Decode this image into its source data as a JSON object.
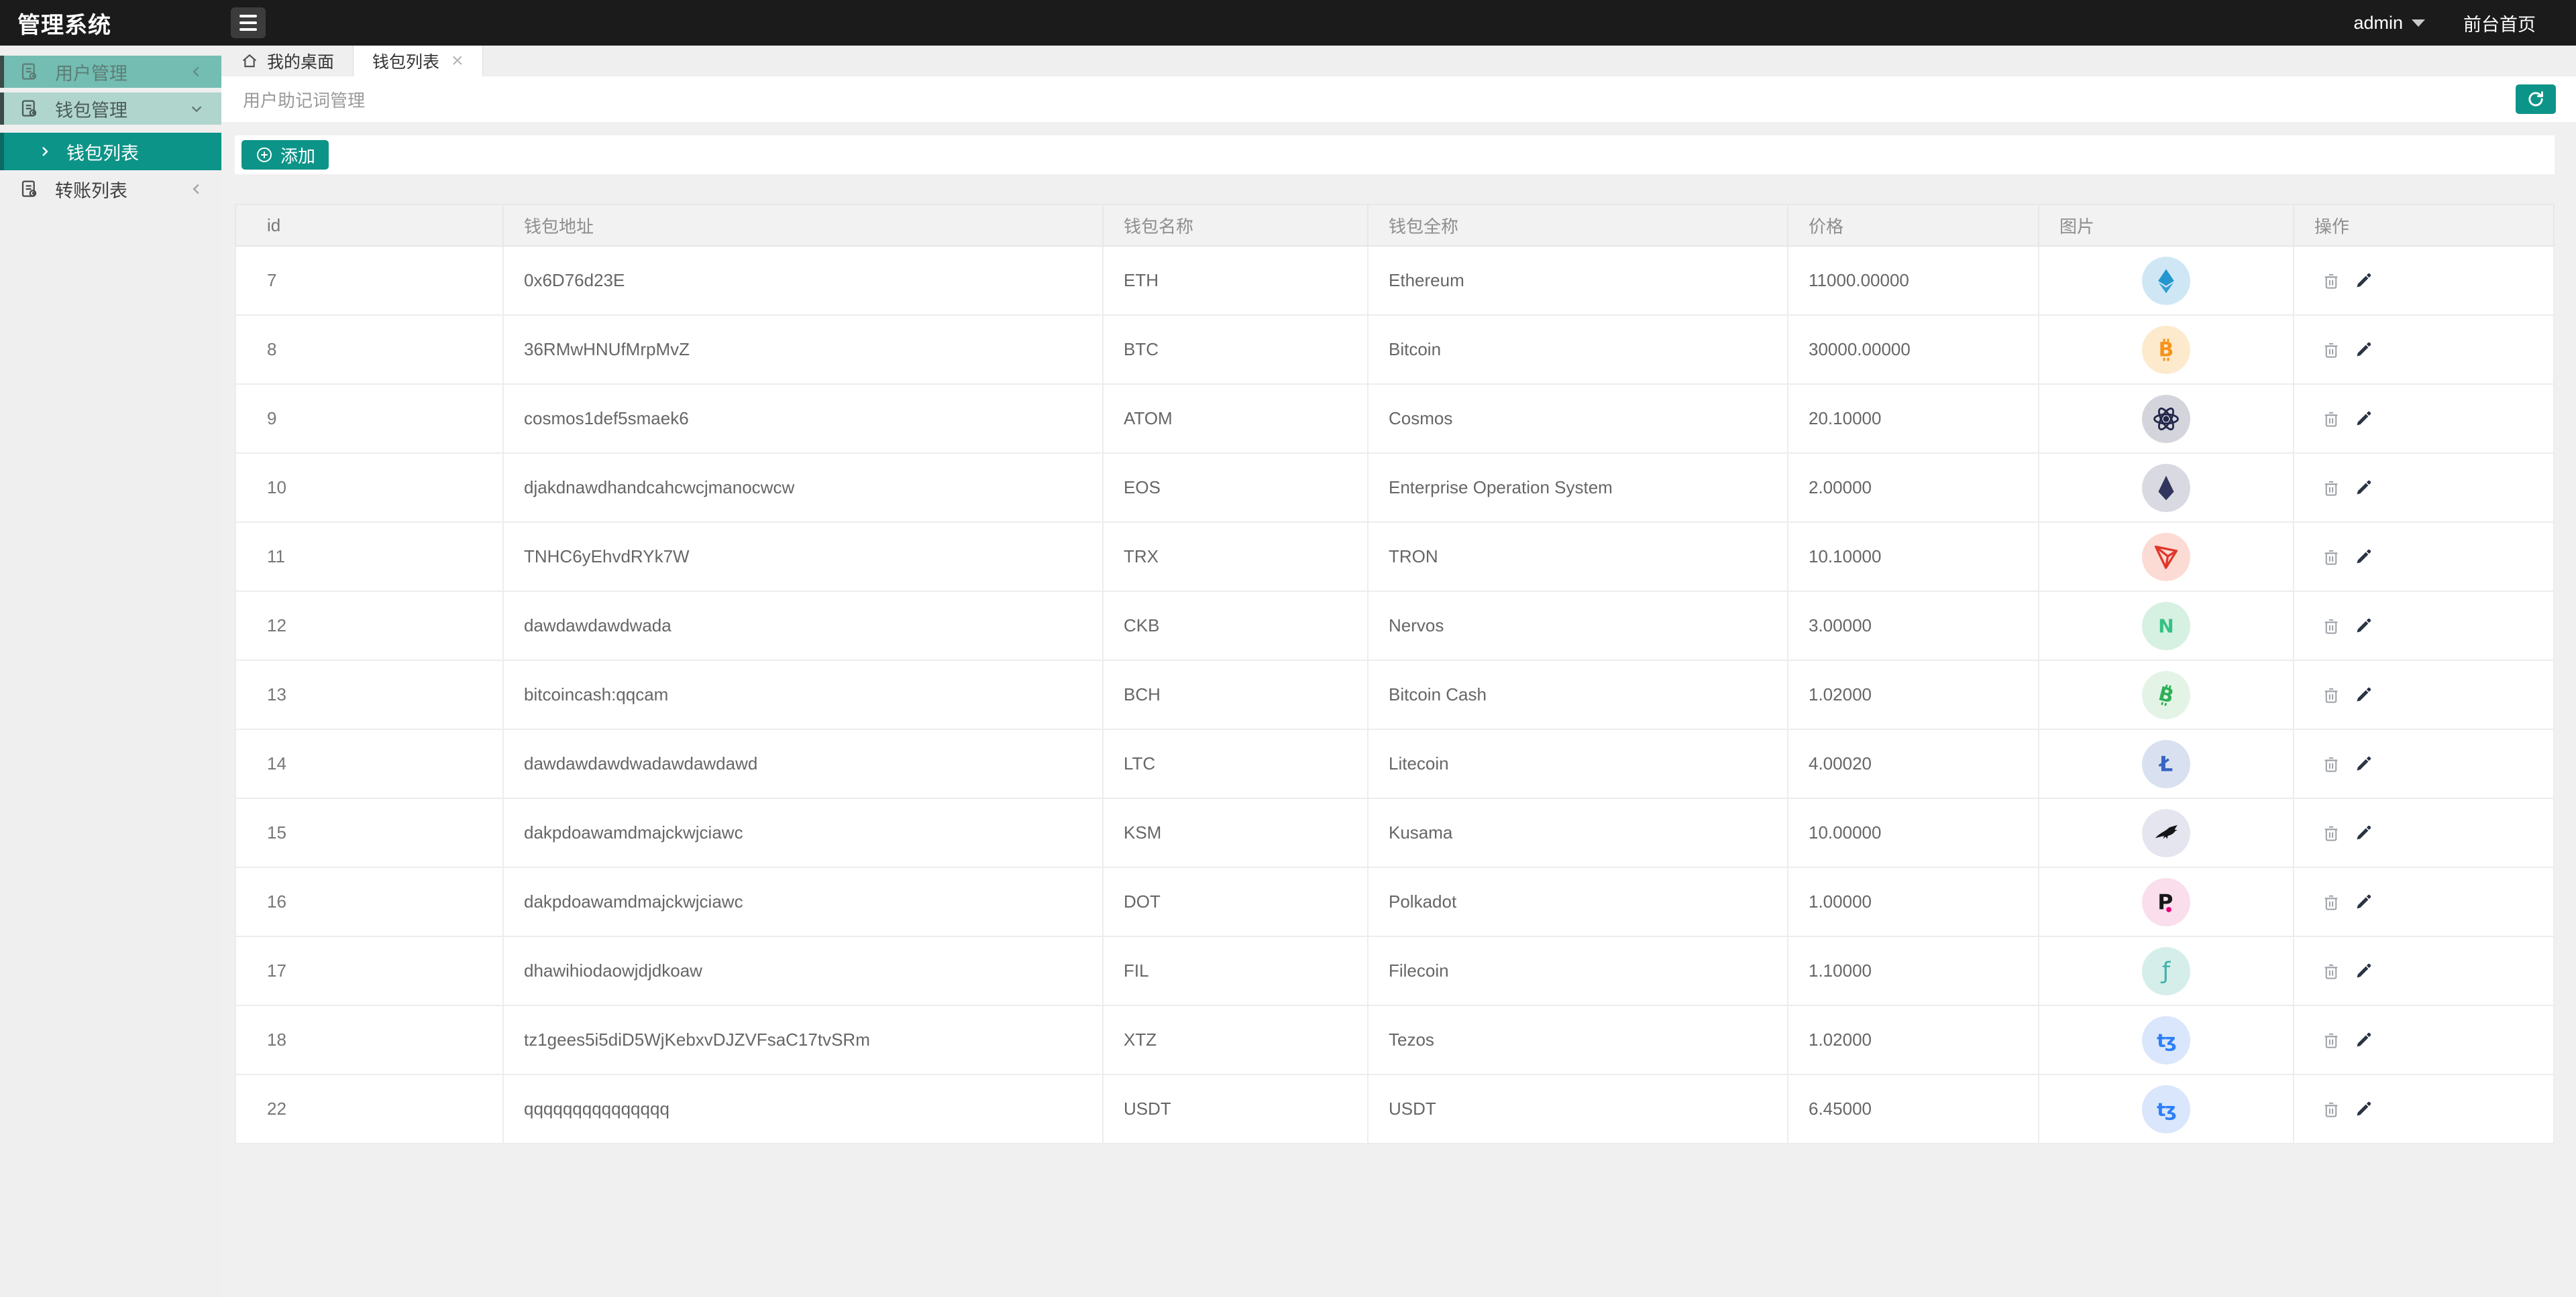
{
  "topbar": {
    "title": "管理系统",
    "user": "admin",
    "front_link": "前台首页"
  },
  "sidebar": {
    "items": [
      {
        "label": "用户管理"
      },
      {
        "label": "钱包管理"
      },
      {
        "label": "钱包列表"
      },
      {
        "label": "转账列表"
      }
    ]
  },
  "tabs": [
    {
      "label": "我的桌面"
    },
    {
      "label": "钱包列表"
    }
  ],
  "page": {
    "subtitle": "用户助记词管理"
  },
  "toolbar": {
    "add_label": "添加"
  },
  "table": {
    "columns": [
      "id",
      "钱包地址",
      "钱包名称",
      "钱包全称",
      "价格",
      "图片",
      "操作"
    ],
    "row_actions": [
      {
        "name": "delete",
        "icon": "trash-icon"
      },
      {
        "name": "edit",
        "icon": "pencil-icon"
      }
    ],
    "rows": [
      {
        "id": "7",
        "address": "0x6D76d23E",
        "name": "ETH",
        "full_name": "Ethereum",
        "price": "11000.00000",
        "icon": {
          "name": "eth-icon",
          "glyph": "eth",
          "bg": "#cfe7f5",
          "color": "#2496cf"
        }
      },
      {
        "id": "8",
        "address": "36RMwHNUfMrpMvZ",
        "name": "BTC",
        "full_name": "Bitcoin",
        "price": "30000.00000",
        "icon": {
          "name": "btc-icon",
          "glyph": "btc",
          "bg": "#fdeacc",
          "color": "#f7931a"
        }
      },
      {
        "id": "9",
        "address": "cosmos1def5smaek6",
        "name": "ATOM",
        "full_name": "Cosmos",
        "price": "20.10000",
        "icon": {
          "name": "atom-icon",
          "glyph": "atom",
          "bg": "#d4d5dc",
          "color": "#22264a"
        }
      },
      {
        "id": "10",
        "address": "djakdnawdhandcahcwcjmanocwcw",
        "name": "EOS",
        "full_name": "Enterprise Operation System",
        "price": "2.00000",
        "icon": {
          "name": "eos-icon",
          "glyph": "eos",
          "bg": "#d9d9e1",
          "color": "#32365e"
        }
      },
      {
        "id": "11",
        "address": "TNHC6yEhvdRYk7W",
        "name": "TRX",
        "full_name": "TRON",
        "price": "10.10000",
        "icon": {
          "name": "trx-icon",
          "glyph": "trx",
          "bg": "#fbdbd3",
          "color": "#e0372b"
        }
      },
      {
        "id": "12",
        "address": "dawdawdawdwada",
        "name": "CKB",
        "full_name": "Nervos",
        "price": "3.00000",
        "icon": {
          "name": "ckb-icon",
          "glyph": "ckb",
          "bg": "#d6f0e2",
          "color": "#35c184"
        }
      },
      {
        "id": "13",
        "address": "bitcoincash:qqcam",
        "name": "BCH",
        "full_name": "Bitcoin Cash",
        "price": "1.02000",
        "icon": {
          "name": "bch-icon",
          "glyph": "bch",
          "bg": "#e3f4e7",
          "color": "#2fb157"
        }
      },
      {
        "id": "14",
        "address": "dawdawdawdwadawdawdawd",
        "name": "LTC",
        "full_name": "Litecoin",
        "price": "4.00020",
        "icon": {
          "name": "ltc-icon",
          "glyph": "ltc",
          "bg": "#d9e1f1",
          "color": "#3a63c2"
        }
      },
      {
        "id": "15",
        "address": "dakpdoawamdmajckwjciawc",
        "name": "KSM",
        "full_name": "Kusama",
        "price": "10.00000",
        "icon": {
          "name": "ksm-icon",
          "glyph": "ksm",
          "bg": "#e5e5ef",
          "color": "#15151a"
        }
      },
      {
        "id": "16",
        "address": "dakpdoawamdmajckwjciawc",
        "name": "DOT",
        "full_name": "Polkadot",
        "price": "1.00000",
        "icon": {
          "name": "dot-icon",
          "glyph": "dot",
          "bg": "#fadeec",
          "color": "#171717",
          "accent": "#e6007a"
        }
      },
      {
        "id": "17",
        "address": "dhawihiodaowjdjdkoaw",
        "name": "FIL",
        "full_name": "Filecoin",
        "price": "1.10000",
        "icon": {
          "name": "fil-icon",
          "glyph": "fil",
          "bg": "#d6eeea",
          "color": "#3fb3ab"
        }
      },
      {
        "id": "18",
        "address": "tz1gees5i5diD5WjKebxvDJZVFsaC17tvSRm",
        "name": "XTZ",
        "full_name": "Tezos",
        "price": "1.02000",
        "icon": {
          "name": "xtz-icon",
          "glyph": "xtz",
          "bg": "#d9e6fb",
          "color": "#2c7ff8"
        }
      },
      {
        "id": "22",
        "address": "qqqqqqqqqqqqqqq",
        "name": "USDT",
        "full_name": "USDT",
        "price": "6.45000",
        "icon": {
          "name": "xtz-icon",
          "glyph": "xtz",
          "bg": "#d9e6fb",
          "color": "#2c7ff8"
        }
      }
    ]
  },
  "colors": {
    "accent": "#0d9488"
  }
}
